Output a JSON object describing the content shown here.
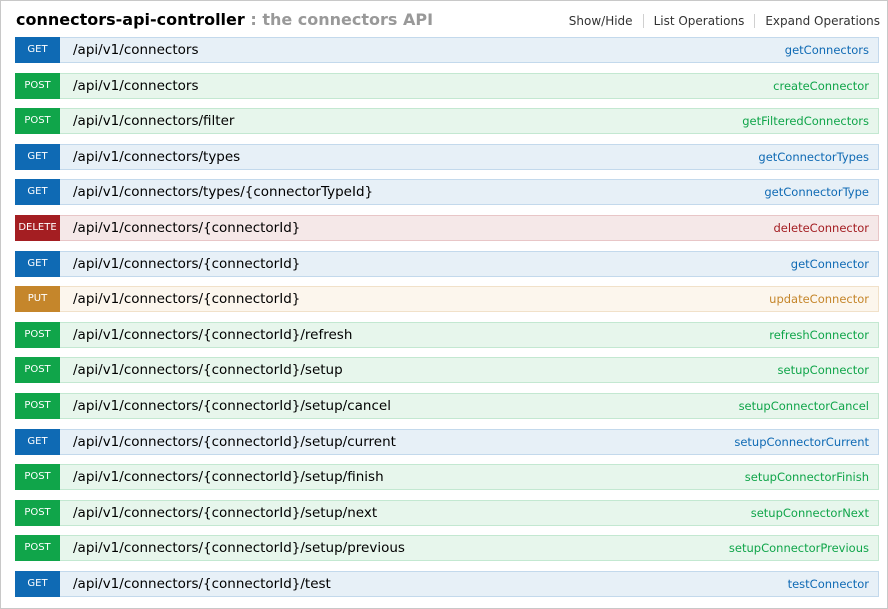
{
  "controller": {
    "name": "connectors-api-controller",
    "description": " : the connectors API"
  },
  "header_links": [
    "Show/Hide",
    "List Operations",
    "Expand Operations"
  ],
  "operations": [
    {
      "method": "GET",
      "path": "/api/v1/connectors",
      "operation_id": "getConnectors"
    },
    {
      "method": "POST",
      "path": "/api/v1/connectors",
      "operation_id": "createConnector"
    },
    {
      "method": "POST",
      "path": "/api/v1/connectors/filter",
      "operation_id": "getFilteredConnectors"
    },
    {
      "method": "GET",
      "path": "/api/v1/connectors/types",
      "operation_id": "getConnectorTypes"
    },
    {
      "method": "GET",
      "path": "/api/v1/connectors/types/{connectorTypeId}",
      "operation_id": "getConnectorType"
    },
    {
      "method": "DELETE",
      "path": "/api/v1/connectors/{connectorId}",
      "operation_id": "deleteConnector"
    },
    {
      "method": "GET",
      "path": "/api/v1/connectors/{connectorId}",
      "operation_id": "getConnector"
    },
    {
      "method": "PUT",
      "path": "/api/v1/connectors/{connectorId}",
      "operation_id": "updateConnector"
    },
    {
      "method": "POST",
      "path": "/api/v1/connectors/{connectorId}/refresh",
      "operation_id": "refreshConnector"
    },
    {
      "method": "POST",
      "path": "/api/v1/connectors/{connectorId}/setup",
      "operation_id": "setupConnector"
    },
    {
      "method": "POST",
      "path": "/api/v1/connectors/{connectorId}/setup/cancel",
      "operation_id": "setupConnectorCancel"
    },
    {
      "method": "GET",
      "path": "/api/v1/connectors/{connectorId}/setup/current",
      "operation_id": "setupConnectorCurrent"
    },
    {
      "method": "POST",
      "path": "/api/v1/connectors/{connectorId}/setup/finish",
      "operation_id": "setupConnectorFinish"
    },
    {
      "method": "POST",
      "path": "/api/v1/connectors/{connectorId}/setup/next",
      "operation_id": "setupConnectorNext"
    },
    {
      "method": "POST",
      "path": "/api/v1/connectors/{connectorId}/setup/previous",
      "operation_id": "setupConnectorPrevious"
    },
    {
      "method": "GET",
      "path": "/api/v1/connectors/{connectorId}/test",
      "operation_id": "testConnector"
    }
  ]
}
